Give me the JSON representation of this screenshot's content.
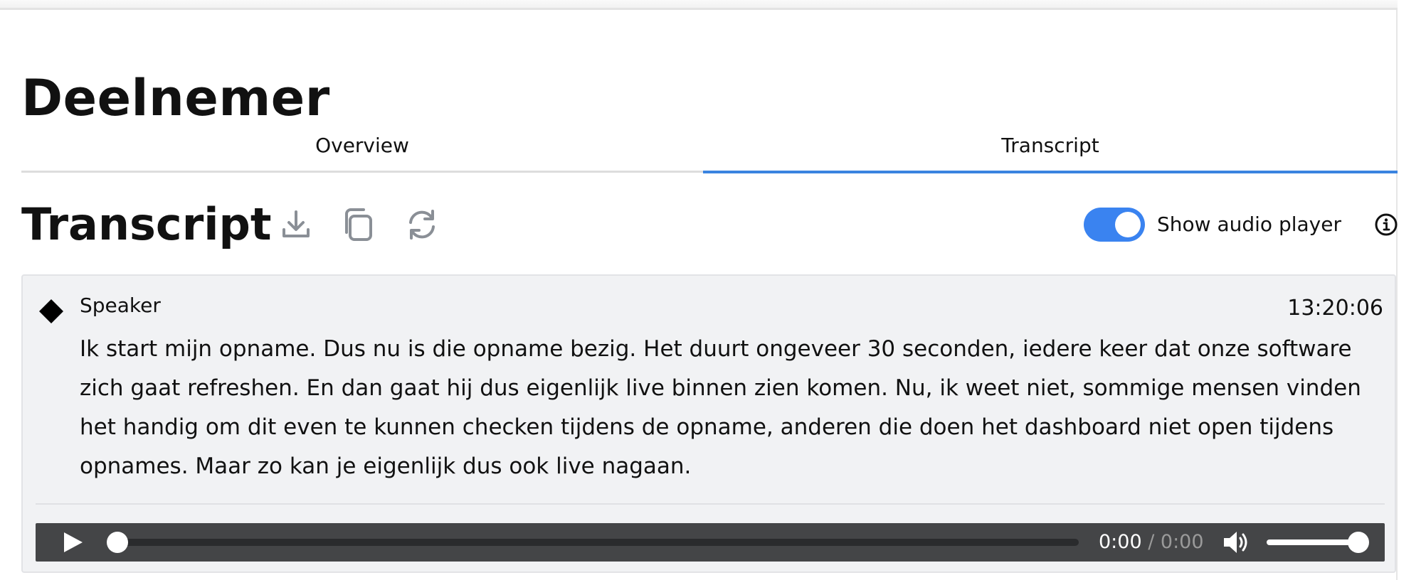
{
  "page": {
    "title": "Deelnemer"
  },
  "tabs": [
    {
      "label": "Overview",
      "active": false
    },
    {
      "label": "Transcript",
      "active": true
    }
  ],
  "transcript": {
    "heading": "Transcript",
    "actions": [
      "download-icon",
      "copy-icon",
      "refresh-icon"
    ],
    "audio_toggle": {
      "label": "Show audio player",
      "on": true
    },
    "info_icon": "info-icon"
  },
  "segment": {
    "speaker": "Speaker",
    "speaker_icon": "diamond-icon",
    "timestamp": "13:20:06",
    "text": "Ik start mijn opname. Dus nu is die opname bezig. Het duurt ongeveer 30 seconden, iedere keer dat onze software zich gaat refreshen. En dan gaat hij dus eigenlijk live binnen zien komen. Nu, ik weet niet, sommige mensen vinden het handig om dit even te kunnen checken tijdens de opname, anderen die doen het dashboard niet open tijdens opnames. Maar zo kan je eigenlijk dus ook live nagaan."
  },
  "audio_player": {
    "current_time": "0:00",
    "separator": " / ",
    "duration": "0:00",
    "progress": 0,
    "volume": 1.0
  },
  "colors": {
    "accent": "#3a83e0",
    "toggle_on": "#3a83f0",
    "card_bg": "#f1f2f4",
    "player_bg": "#444547",
    "icon_gray": "#8a8f96"
  }
}
